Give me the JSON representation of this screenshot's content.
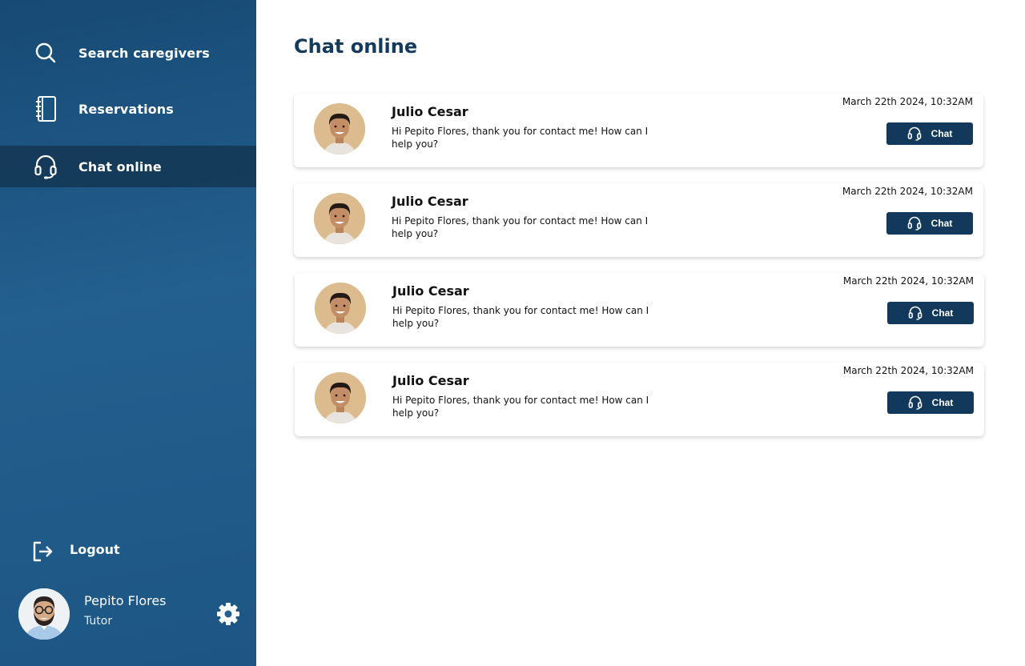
{
  "sidebar": {
    "nav": [
      {
        "label": "Search caregivers",
        "icon": "search-icon",
        "active": false
      },
      {
        "label": "Reservations",
        "icon": "notebook-icon",
        "active": false
      },
      {
        "label": "Chat online",
        "icon": "headset-icon",
        "active": true
      }
    ],
    "logout_label": "Logout",
    "user": {
      "name": "Pepito Flores",
      "role": "Tutor"
    }
  },
  "main": {
    "title": "Chat online",
    "chats": [
      {
        "name": "Julio Cesar",
        "message": "Hi Pepito Flores, thank you for contact me! How can I help you?",
        "time": "March 22th 2024, 10:32AM",
        "button": "Chat"
      },
      {
        "name": "Julio Cesar",
        "message": "Hi Pepito Flores, thank you for contact me! How can I help you?",
        "time": "March 22th 2024, 10:32AM",
        "button": "Chat"
      },
      {
        "name": "Julio Cesar",
        "message": "Hi Pepito Flores, thank you for contact me! How can I help you?",
        "time": "March 22th 2024, 10:32AM",
        "button": "Chat"
      },
      {
        "name": "Julio Cesar",
        "message": "Hi Pepito Flores, thank you for contact me! How can I help you?",
        "time": "March 22th 2024, 10:32AM",
        "button": "Chat"
      }
    ]
  },
  "colors": {
    "sidebar": "#235f8f",
    "active_nav": "#12304b",
    "accent": "#12395c",
    "title": "#143a5c"
  }
}
